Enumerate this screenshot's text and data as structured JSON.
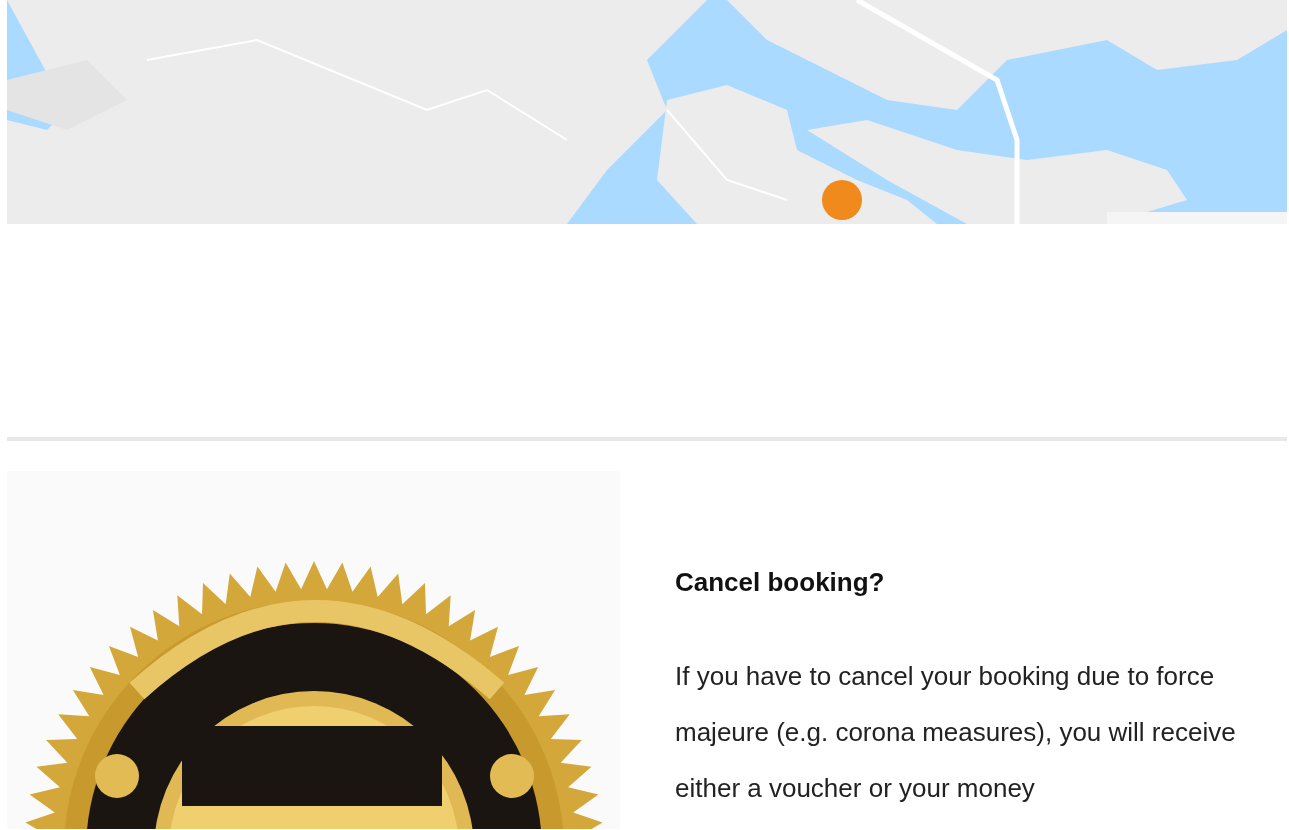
{
  "cancel_section": {
    "heading": "Cancel booking?",
    "body": "If you have to cancel your booking due to force majeure (e.g. corona measures), you will receive either a voucher or your money"
  }
}
